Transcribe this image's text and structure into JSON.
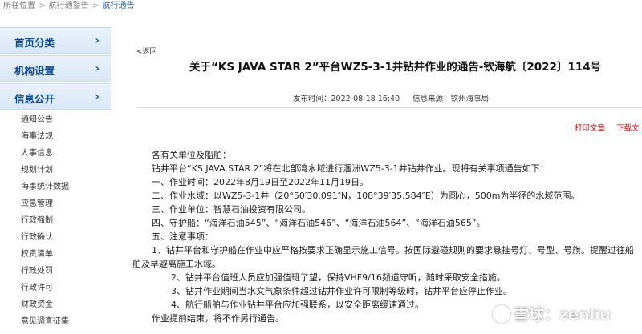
{
  "breadcrumb": {
    "prefix": "所在位置",
    "sep": ">",
    "item1": "航行通警告",
    "item2": "航行通告"
  },
  "sidebar": {
    "nav1": "首页分类",
    "nav2": "机构设置",
    "nav3": "信息公开",
    "chevron": "›",
    "items": [
      "通知公告",
      "海事法规",
      "人事信息",
      "规划计划",
      "海事统计数据",
      "应急管理",
      "行政强制",
      "行政确认",
      "权责清单",
      "行政处罚",
      "行政许可",
      "财政资金",
      "意见调查征集"
    ]
  },
  "back": "<返回",
  "article": {
    "title": "关于“KS JAVA STAR 2”平台WZ5-3-1井钻井作业的通告-钦海航〔2022〕114号",
    "publish_time": "发布时间：2022-08-18 16:40",
    "source": "信息来源：钦州海事局",
    "print": "打印文章",
    "download": "下载文",
    "paragraphs": [
      "各有关单位及船舶：",
      "钻井平台“KS JAVA STAR 2”将在北部湾水域进行涠洲WZ5-3-1井钻井作业。现将有关事项通告如下：",
      "一、作业时间：2022年8月19日至2022年11月19日。",
      "二、作业水域：以WZ5-3-1井（20°50′30.091″N，108°39′35.584″E）为圆心，500m为半径的水域范围。",
      "三、作业单位：智慧石油投资有限公司。",
      "四、守护船：“海洋石油545”、“海洋石油546”、“海洋石油564”、“海洋石油565”。",
      "五、注意事项：",
      "1、钻井平台和守护船在作业中应严格按要求正确显示施工信号。按国际避碰规则的要求悬挂号灯、号型、号旗。提醒过往船舶及早避离施工水域。",
      "2、钻井平台值班人员应加强值班了望，保持VHF9/16频道守听，随时采取安全措施。",
      "3、钻井作业期间当水文气象条件超过钻井作业许可限制等级时，钻井平台应停止作业。",
      "4、航行船舶与作业钻井平台应加强联系，以安全距离缓速通过。",
      "作业提前结束，将不作另行通告。"
    ]
  },
  "watermark": {
    "text": "雪球：zenliu"
  },
  "colors": {
    "nav_text": "#0f4b8c",
    "link": "#1a5fa3",
    "tools": "#cc0000"
  }
}
